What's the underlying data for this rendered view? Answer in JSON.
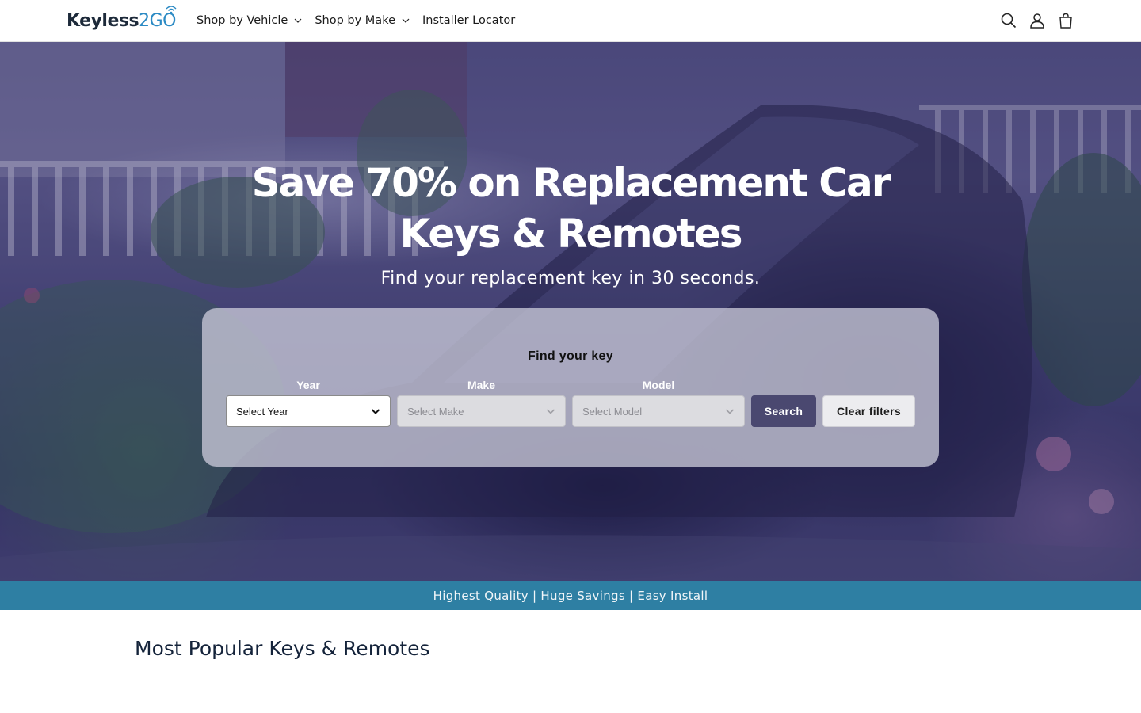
{
  "header": {
    "logo": {
      "part1": "Keyless",
      "part2": "2GO"
    },
    "nav": [
      {
        "label": "Shop by Vehicle",
        "icon": "chevron-down-icon"
      },
      {
        "label": "Shop by Make",
        "icon": "chevron-down-icon"
      },
      {
        "label": "Installer Locator"
      }
    ],
    "icons": [
      "search-icon",
      "account-icon",
      "cart-icon"
    ]
  },
  "hero": {
    "title": "Save 70% on Replacement Car Keys & Remotes",
    "subtitle": "Find your replacement key in 30 seconds."
  },
  "finder": {
    "title": "Find your key",
    "year_label": "Year",
    "make_label": "Make",
    "model_label": "Model",
    "year_value": "Select Year",
    "make_value": "Select Make",
    "model_value": "Select Model",
    "search_label": "Search",
    "clear_label": "Clear filters"
  },
  "banner": {
    "text": "Highest Quality | Huge Savings | Easy Install"
  },
  "section": {
    "title": "Most Popular Keys & Remotes"
  },
  "colors": {
    "banner": "#2e7fa3",
    "search_button": "#4a4870",
    "brand_dark": "#1d2a3a",
    "brand_accent": "#2b8ac4"
  }
}
